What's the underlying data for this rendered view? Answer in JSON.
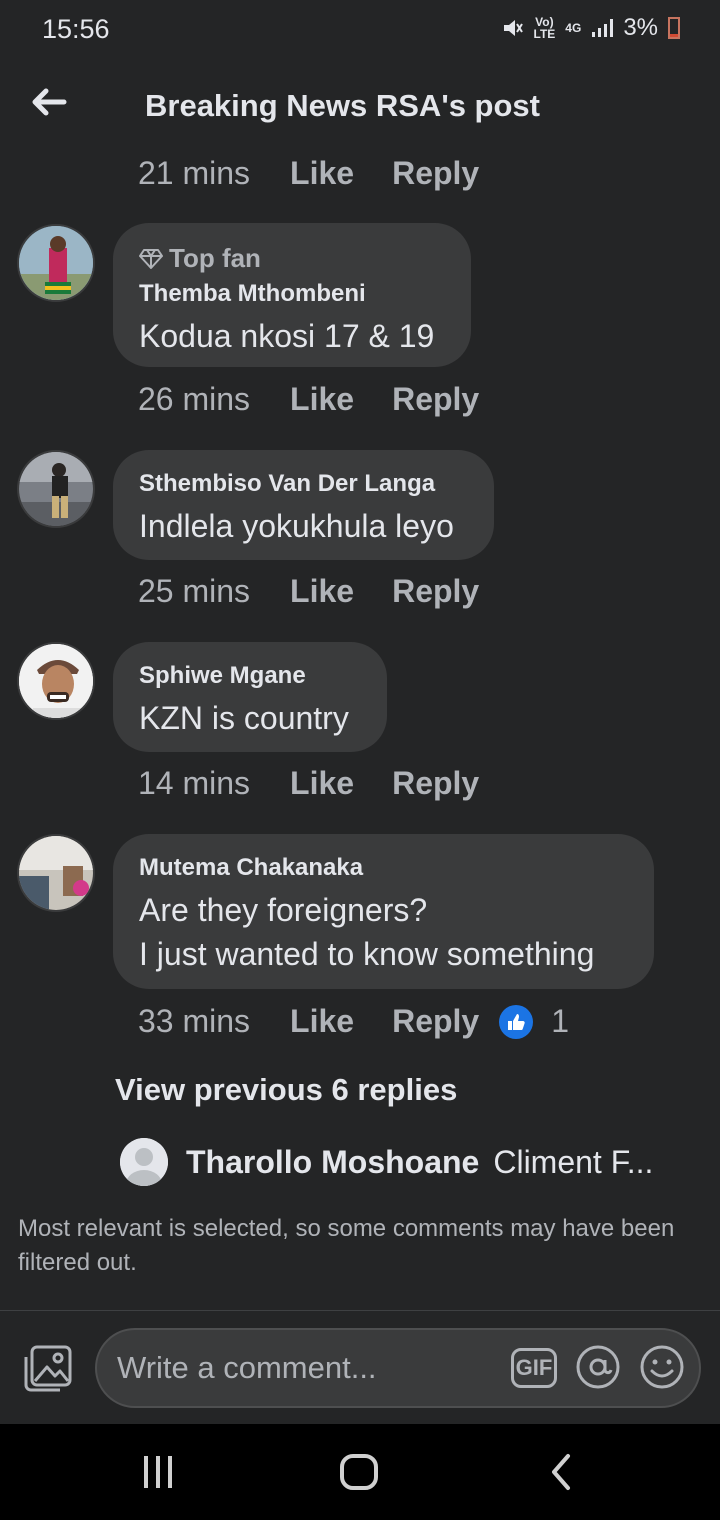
{
  "status_bar": {
    "time": "15:56",
    "network_top": "Vo)",
    "network_bottom": "LTE",
    "data_type": "4G",
    "battery": "3%"
  },
  "header": {
    "title": "Breaking News RSA's post"
  },
  "first_meta": {
    "time": "21 mins",
    "like": "Like",
    "reply": "Reply"
  },
  "comments": [
    {
      "badge": "Top fan",
      "name": "Themba Mthombeni",
      "text": "Kodua nkosi 17 & 19",
      "time": "26 mins",
      "like": "Like",
      "reply": "Reply"
    },
    {
      "name": "Sthembiso Van Der Langa",
      "text": "Indlela yokukhula leyo",
      "time": "25 mins",
      "like": "Like",
      "reply": "Reply"
    },
    {
      "name": "Sphiwe Mgane",
      "text": "KZN is country",
      "time": "14 mins",
      "like": "Like",
      "reply": "Reply"
    },
    {
      "name": "Mutema Chakanaka",
      "text_line1": "Are they foreigners?",
      "text_line2": "I just wanted to know something",
      "time": "33 mins",
      "like": "Like",
      "reply": "Reply",
      "reactions": "1"
    }
  ],
  "view_previous": "View previous 6 replies",
  "reply_preview": {
    "name": "Tharollo Moshoane",
    "text": "Climent F..."
  },
  "filter_note": "Most relevant is selected, so some comments may have been filtered out.",
  "composer": {
    "placeholder": "Write a comment...",
    "gif": "GIF"
  }
}
